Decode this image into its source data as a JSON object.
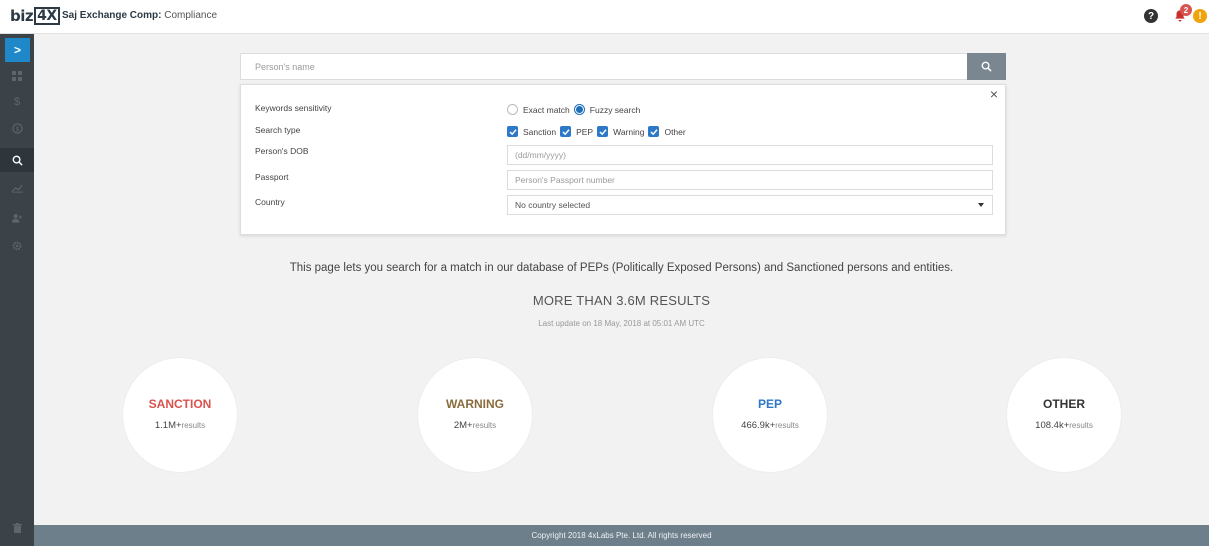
{
  "header": {
    "logo_text": "biz",
    "logo_box_text": "4X",
    "company": "Saj Exchange Comp:",
    "section": "Compliance",
    "help_icon_glyph": "?",
    "notification_count": "2",
    "warning_icon_glyph": "!"
  },
  "sidebar": {
    "toggle_glyph": ">",
    "items": [
      {
        "icon": "dashboard-icon"
      },
      {
        "icon": "dollar-icon"
      },
      {
        "icon": "exchange-icon"
      },
      {
        "icon": "search-icon",
        "active": true
      },
      {
        "icon": "chart-icon"
      },
      {
        "icon": "users-icon"
      },
      {
        "icon": "gear-icon"
      }
    ],
    "bottom_icon": "trash-icon"
  },
  "search": {
    "placeholder": "Person's name",
    "value": ""
  },
  "filters": {
    "keywords_label": "Keywords sensitivity",
    "exact_label": "Exact match",
    "fuzzy_label": "Fuzzy search",
    "selected_sensitivity": "Fuzzy search",
    "search_type_label": "Search type",
    "types": [
      {
        "label": "Sanction",
        "checked": true
      },
      {
        "label": "PEP",
        "checked": true
      },
      {
        "label": "Warning",
        "checked": true
      },
      {
        "label": "Other",
        "checked": true
      }
    ],
    "dob_label": "Person's DOB",
    "dob_placeholder": "(dd/mm/yyyy)",
    "passport_label": "Passport",
    "passport_placeholder": "Person's Passport number",
    "country_label": "Country",
    "country_value": "No country selected"
  },
  "info": {
    "intro": "This page lets you search for a match in our database of PEPs (Politically Exposed Persons) and Sanctioned persons and entities.",
    "total": "MORE THAN 3.6M RESULTS",
    "last_update": "Last update on 18 May, 2018 at 05:01 AM UTC"
  },
  "stats": [
    {
      "title": "SANCTION",
      "count": "1.1M+",
      "unit": "results",
      "color": "#d9534f"
    },
    {
      "title": "WARNING",
      "count": "2M+",
      "unit": "results",
      "color": "#8b6b3d"
    },
    {
      "title": "PEP",
      "count": "466.9k+",
      "unit": "results",
      "color": "#2d79c7"
    },
    {
      "title": "OTHER",
      "count": "108.4k+",
      "unit": "results",
      "color": "#333333"
    }
  ],
  "footer": {
    "copyright": "Copyright 2018 4xLabs Pte. Ltd. All rights reserved"
  }
}
